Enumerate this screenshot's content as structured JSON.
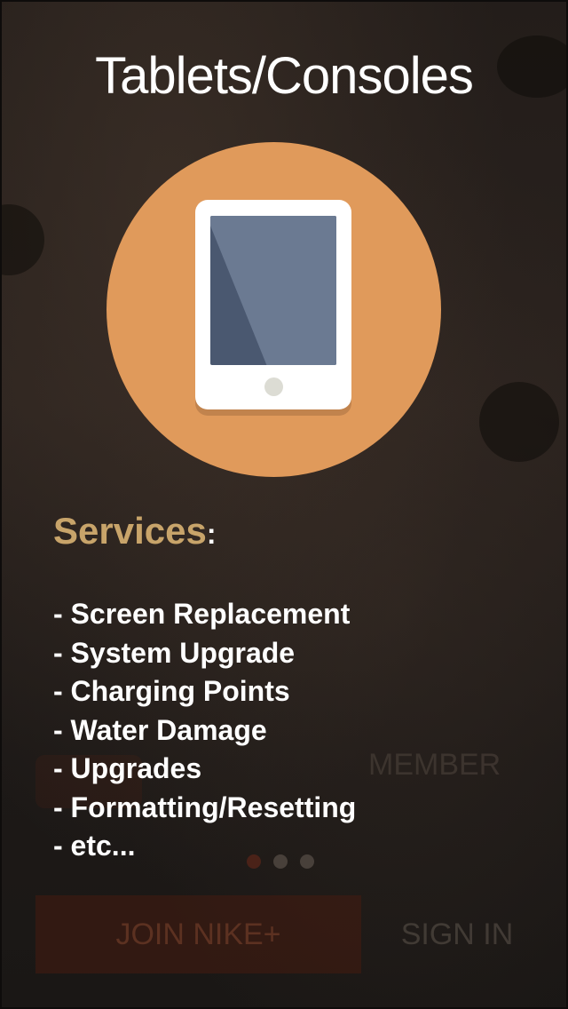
{
  "header": {
    "title": "Tablets/Consoles"
  },
  "hero": {
    "icon": "tablet-icon",
    "circle_color": "#e09a5b"
  },
  "services": {
    "heading": "Services",
    "colon": ":",
    "items": [
      "- Screen Replacement",
      "- System Upgrade",
      "- Charging Points",
      "- Water Damage",
      "- Upgrades",
      "- Formatting/Resetting",
      "- etc..."
    ]
  },
  "background_ui": {
    "member_text": "MEMBER",
    "join_label": "JOIN NIKE+",
    "signin_label": "SIGN IN",
    "page_dots": 3,
    "active_dot": 0
  },
  "colors": {
    "accent": "#c8a46a",
    "text": "#ffffff"
  }
}
